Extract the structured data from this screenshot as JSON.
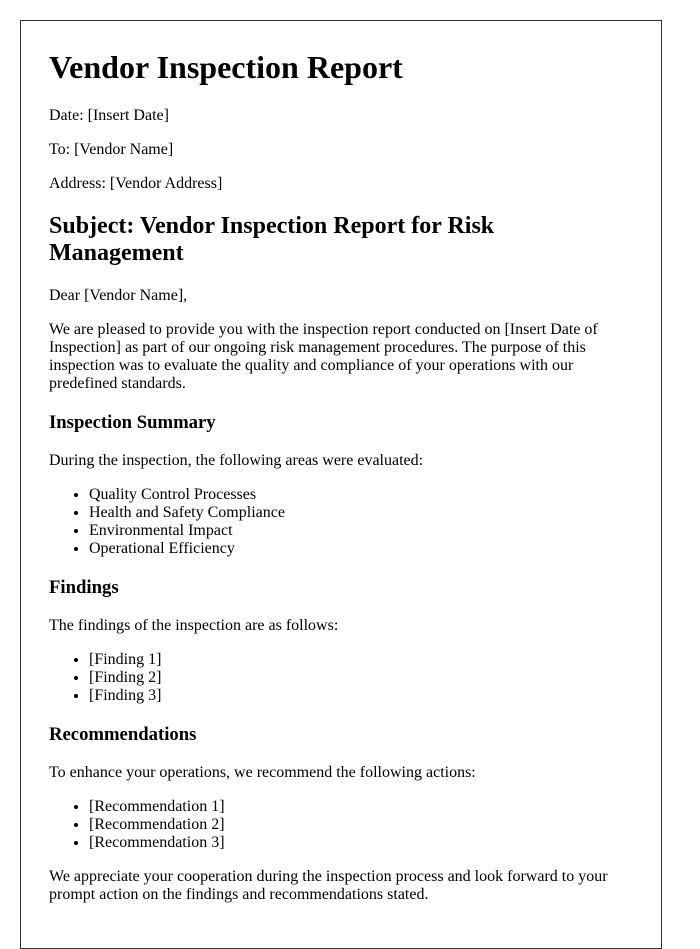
{
  "document": {
    "title": "Vendor Inspection Report",
    "meta": {
      "date": "Date: [Insert Date]",
      "to": "To: [Vendor Name]",
      "address": "Address: [Vendor Address]"
    },
    "subject": "Subject: Vendor Inspection Report for Risk Management",
    "salutation": "Dear [Vendor Name],",
    "intro": "We are pleased to provide you with the inspection report conducted on [Insert Date of Inspection] as part of our ongoing risk management procedures. The purpose of this inspection was to evaluate the quality and compliance of your operations with our predefined standards.",
    "sections": {
      "summary": {
        "heading": "Inspection Summary",
        "lead": "During the inspection, the following areas were evaluated:",
        "items": [
          "Quality Control Processes",
          "Health and Safety Compliance",
          "Environmental Impact",
          "Operational Efficiency"
        ]
      },
      "findings": {
        "heading": "Findings",
        "lead": "The findings of the inspection are as follows:",
        "items": [
          "[Finding 1]",
          "[Finding 2]",
          "[Finding 3]"
        ]
      },
      "recommendations": {
        "heading": "Recommendations",
        "lead": "To enhance your operations, we recommend the following actions:",
        "items": [
          "[Recommendation 1]",
          "[Recommendation 2]",
          "[Recommendation 3]"
        ]
      }
    },
    "closing": "We appreciate your cooperation during the inspection process and look forward to your prompt action on the findings and recommendations stated."
  }
}
